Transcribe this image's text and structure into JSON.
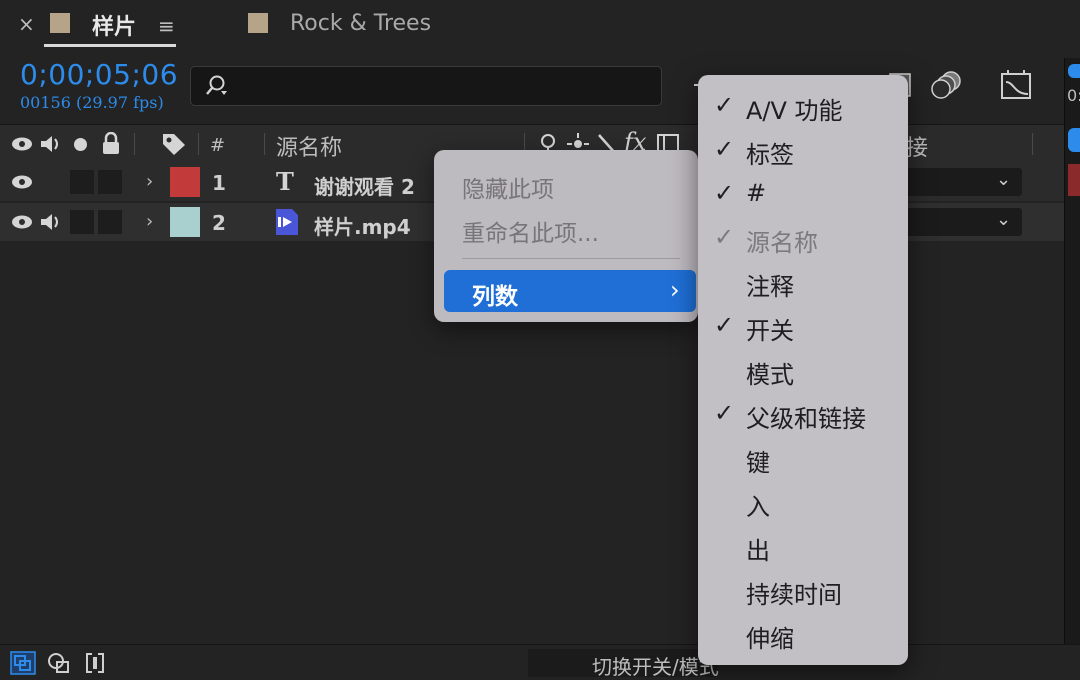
{
  "tabs": {
    "active": {
      "label": "样片",
      "close": "×",
      "menu": "≡",
      "color": "#b6a488"
    },
    "other": {
      "label": "Rock & Trees",
      "color": "#b6a488"
    }
  },
  "time": {
    "timecode": "0;00;05;06",
    "frames": "00156 (29.97 fps)"
  },
  "search": {
    "placeholder": ""
  },
  "header": {
    "hash": "#",
    "source_name": "源名称",
    "fx": "fx",
    "parent_link": "接"
  },
  "layers": [
    {
      "num": "1",
      "name": "谢谢观看 2",
      "type_icon": "T",
      "label_color": "#c23a3a"
    },
    {
      "num": "2",
      "name": "样片.mp4",
      "type_icon": "video",
      "label_color": "#a9d0cf"
    }
  ],
  "context_menu": {
    "hide": "隐藏此项",
    "rename": "重命名此项...",
    "columns": "列数"
  },
  "columns_submenu": [
    {
      "label": "A/V 功能",
      "checked": true,
      "disabled": false
    },
    {
      "label": "标签",
      "checked": true,
      "disabled": false
    },
    {
      "label": "#",
      "checked": true,
      "disabled": false
    },
    {
      "label": "源名称",
      "checked": true,
      "disabled": true
    },
    {
      "label": "注释",
      "checked": false,
      "disabled": false
    },
    {
      "label": "开关",
      "checked": true,
      "disabled": false
    },
    {
      "label": "模式",
      "checked": false,
      "disabled": false
    },
    {
      "label": "父级和链接",
      "checked": true,
      "disabled": false
    },
    {
      "label": "键",
      "checked": false,
      "disabled": false
    },
    {
      "label": "入",
      "checked": false,
      "disabled": false
    },
    {
      "label": "出",
      "checked": false,
      "disabled": false
    },
    {
      "label": "持续时间",
      "checked": false,
      "disabled": false
    },
    {
      "label": "伸缩",
      "checked": false,
      "disabled": false
    }
  ],
  "bottom": {
    "toggle_label": "切换开关/模式"
  },
  "glyphs": {
    "check": "✓"
  },
  "colors": {
    "accent": "#2d8ceb",
    "highlight": "#1f6fd6"
  }
}
